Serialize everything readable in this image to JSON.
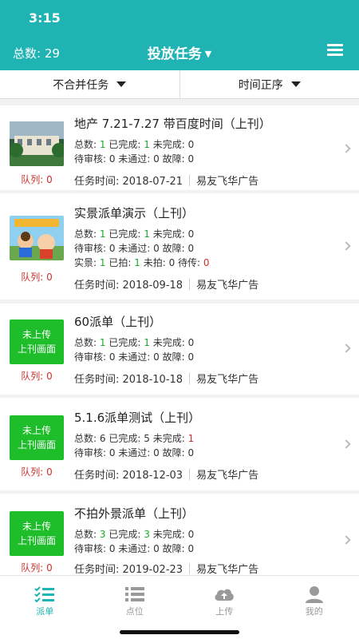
{
  "status_bar": {
    "time": "3:15"
  },
  "header": {
    "total_label": "总数: 29",
    "title": "投放任务",
    "menu_icon": "menu-icon"
  },
  "filters": {
    "merge": "不合并任务",
    "sort": "时间正序"
  },
  "tasks": [
    {
      "title": "地产 7.21-7.27 带百度时间（上刊）",
      "thumb_type": "image",
      "queue": "队列: 0",
      "l1": {
        "total_label": "总数:",
        "total": "1",
        "done_label": "已完成:",
        "done": "1",
        "undone_label": "未完成:",
        "undone": "0"
      },
      "l2": "待审核: 0 未通过: 0 故障: 0",
      "time": "任务时间: 2018-07-21",
      "company": "易友飞华广告"
    },
    {
      "title": "实景派单演示（上刊）",
      "thumb_type": "image",
      "queue": "队列: 0",
      "l1": {
        "total_label": "总数:",
        "total": "1",
        "done_label": "已完成:",
        "done": "1",
        "undone_label": "未完成:",
        "undone": "0"
      },
      "l2": "待审核: 0 未通过: 0 故障: 0",
      "l3": {
        "shot_total_label": "实景:",
        "shot_total": "1",
        "shot_done_label": "已拍:",
        "shot_done": "1",
        "shot_pending_label": "未拍:",
        "shot_pending": "0",
        "to_upload_label": "待传:",
        "to_upload": "0"
      },
      "time": "任务时间: 2018-09-18",
      "company": "易友飞华广告"
    },
    {
      "title": "60派单（上刊）",
      "thumb_type": "green",
      "thumb_line1": "未上传",
      "thumb_line2": "上刊画面",
      "queue": "队列: 0",
      "l1": {
        "total_label": "总数:",
        "total": "1",
        "done_label": "已完成:",
        "done": "1",
        "undone_label": "未完成:",
        "undone": "0"
      },
      "l2": "待审核: 0 未通过: 0 故障: 0",
      "time": "任务时间: 2018-10-18",
      "company": "易友飞华广告"
    },
    {
      "title": "5.1.6派单测试（上刊）",
      "thumb_type": "green",
      "thumb_line1": "未上传",
      "thumb_line2": "上刊画面",
      "queue": "队列: 0",
      "l1": {
        "total_label": "总数:",
        "total": "6",
        "done_label": "已完成:",
        "done": "5",
        "undone_label": "未完成:",
        "undone": "1"
      },
      "l2": "待审核: 0 未通过: 0 故障: 0",
      "time": "任务时间: 2018-12-03",
      "company": "易友飞华广告"
    },
    {
      "title": "不拍外景派单（上刊）",
      "thumb_type": "green",
      "thumb_line1": "未上传",
      "thumb_line2": "上刊画面",
      "queue": "队列: 0",
      "l1": {
        "total_label": "总数:",
        "total": "3",
        "done_label": "已完成:",
        "done": "3",
        "undone_label": "未完成:",
        "undone": "0"
      },
      "l2": "待审核: 0 未通过: 0 故障: 0",
      "time": "任务时间: 2019-02-23",
      "company": "易友飞华广告"
    }
  ],
  "tabbar": [
    {
      "label": "派单",
      "icon": "dispatch-list-icon",
      "active": true
    },
    {
      "label": "点位",
      "icon": "points-list-icon",
      "active": false
    },
    {
      "label": "上传",
      "icon": "cloud-upload-icon",
      "active": false
    },
    {
      "label": "我的",
      "icon": "user-icon",
      "active": false
    }
  ],
  "colors": {
    "brand": "#1fb3b3",
    "green": "#1fa92b",
    "red": "#d0312d"
  }
}
